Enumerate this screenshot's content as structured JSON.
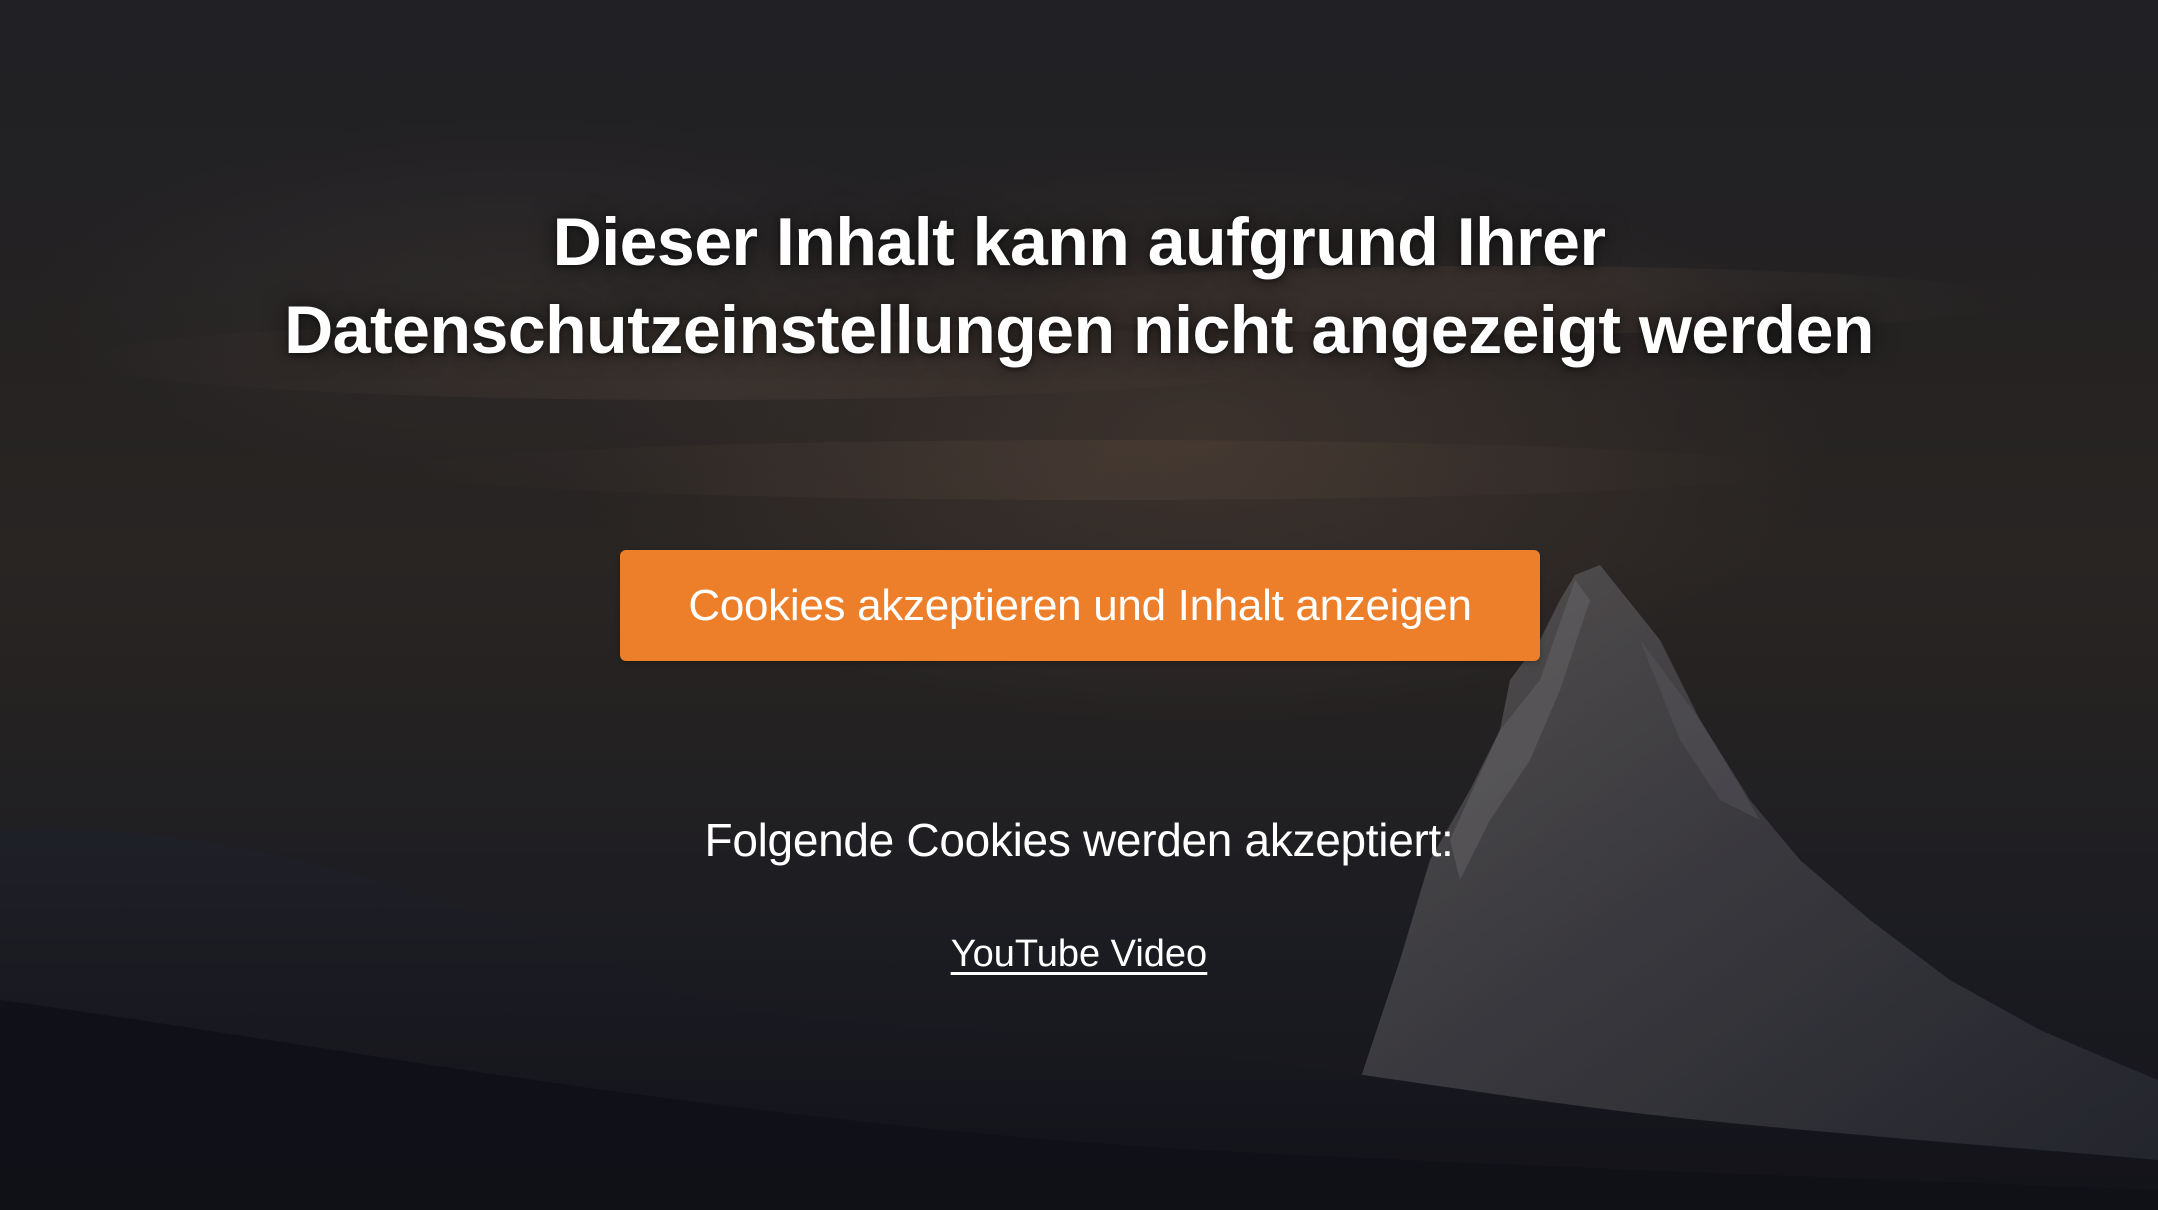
{
  "notice": {
    "headline_line1": "Dieser Inhalt kann aufgrund Ihrer",
    "headline_line2": "Datenschutzeinstellungen nicht angezeigt werden",
    "accept_button_label": "Cookies akzeptieren und Inhalt anzeigen",
    "cookies_note": "Folgende Cookies werden akzeptiert:",
    "cookie_link_label": "YouTube Video"
  },
  "colors": {
    "accent": "#ed7f2a",
    "text": "#ffffff",
    "background": "#1b1c21"
  },
  "background_image": "mountain-peak-dusk-icon"
}
